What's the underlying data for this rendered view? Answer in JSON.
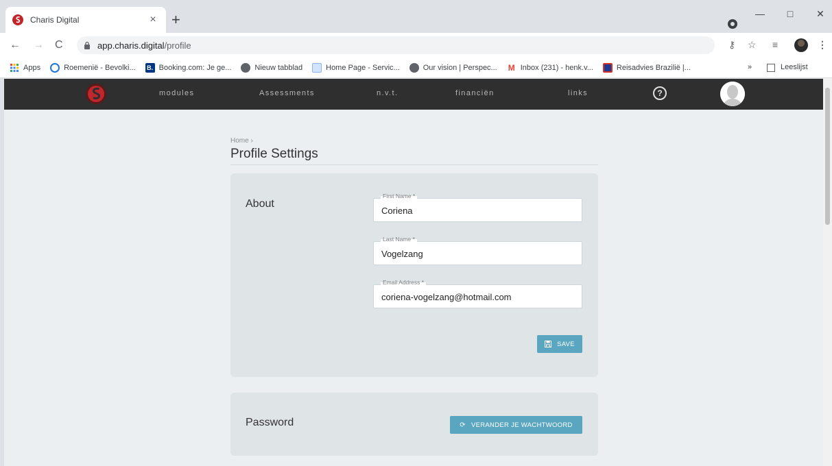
{
  "browser": {
    "tab_title": "Charis Digital",
    "tab_close": "×",
    "new_tab": "+",
    "url_host": "app.charis.digital",
    "url_path": "/profile",
    "window_buttons": {
      "minimize": "—",
      "maximize": "□",
      "close": "✕"
    }
  },
  "bookmarks": {
    "items": [
      {
        "label": "Apps",
        "icon": "apps-grid-icon",
        "color": "#ea4335"
      },
      {
        "label": "Roemenië - Bevolki...",
        "icon": "circle-icon",
        "color": "#1a73e8"
      },
      {
        "label": "Booking.com: Je ge...",
        "icon": "booking-icon",
        "color": "#003580"
      },
      {
        "label": "Nieuw tabblad",
        "icon": "globe-icon",
        "color": "#5f6368"
      },
      {
        "label": "Home Page - Servic...",
        "icon": "page-icon",
        "color": "#8ab4f8"
      },
      {
        "label": "Our vision | Perspec...",
        "icon": "globe-icon",
        "color": "#5f6368"
      },
      {
        "label": "Inbox (231) - henk.v...",
        "icon": "gmail-icon",
        "color": "#ea4335"
      },
      {
        "label": "Reisadvies Brazilië |...",
        "icon": "flag-icon",
        "color": "#d93025"
      }
    ],
    "overflow": "»",
    "reading_list": "Leeslijst"
  },
  "nav": {
    "links": [
      "modules",
      "Assessments",
      "n.v.t.",
      "financiën",
      "links"
    ],
    "help": "?"
  },
  "page": {
    "breadcrumb": "Home ›",
    "title": "Profile Settings"
  },
  "about": {
    "label": "About",
    "first_name_label": "First Name *",
    "first_name": "Coriena",
    "last_name_label": "Last Name *",
    "last_name": "Vogelzang",
    "email_label": "Email Address *",
    "email": "coriena-vogelzang@hotmail.com",
    "save_label": "SAVE"
  },
  "password": {
    "label": "Password",
    "button_label": "VERANDER JE WACHTWOORD"
  },
  "colors": {
    "nav_bg": "#2f2f2f",
    "accent": "#5aa6c0",
    "brand_red": "#c0272d"
  }
}
